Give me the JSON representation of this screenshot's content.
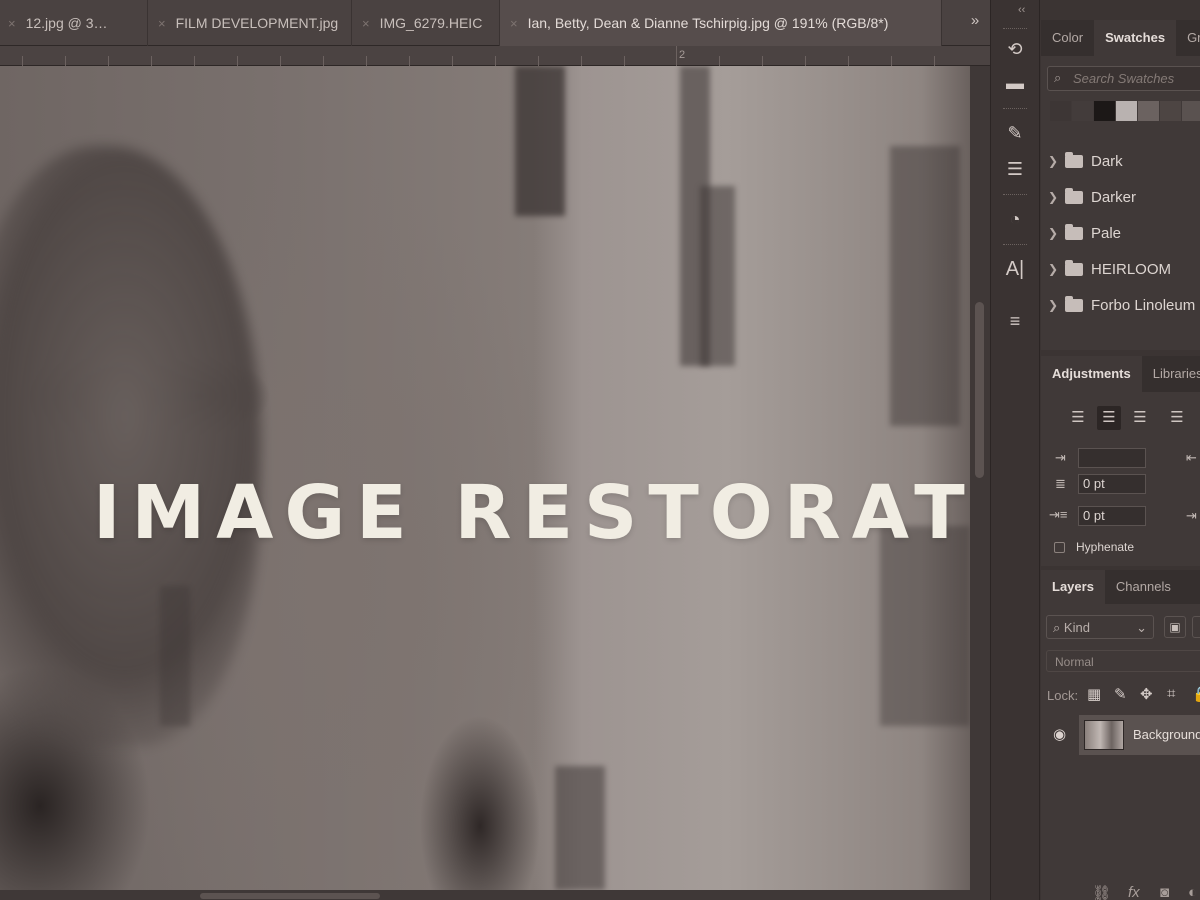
{
  "document_tabs": [
    {
      "label": "12.jpg @ 3…",
      "active": false
    },
    {
      "label": "FILM DEVELOPMENT.jpg",
      "active": false
    },
    {
      "label": "IMG_6279.HEIC",
      "active": false
    },
    {
      "label": "Ian, Betty, Dean & Dianne Tschirpig.jpg @ 191% (RGB/8*)",
      "active": true
    }
  ],
  "tab_close_glyph": "×",
  "tab_overflow_glyph": "»",
  "panel_collapse_glyph": "‹‹",
  "ruler": {
    "label": "2"
  },
  "canvas": {
    "overlay_title": "IMAGE RESTORATION"
  },
  "tools": [
    "history-brush-icon",
    "comment-icon",
    "brush-settings-icon",
    "tool-presets-icon",
    "clone-source-icon",
    "character-icon",
    "paragraph-settings-icon"
  ],
  "swatches_panel": {
    "tabs": [
      "Color",
      "Swatches",
      "Gra"
    ],
    "active_tab": "Swatches",
    "search_placeholder": "Search Swatches",
    "recent_swatches": [
      "#3d3635",
      "#433c3b",
      "#1c1817",
      "#b9b2b0",
      "#6b6260",
      "#4d4543",
      "#5a5250"
    ],
    "folders": [
      "Dark",
      "Darker",
      "Pale",
      "HEIRLOOM",
      "Forbo Linoleum"
    ]
  },
  "adjustments_panel": {
    "tabs": [
      "Adjustments",
      "Libraries"
    ],
    "indent_before": "0 pt",
    "indent_after": "0 pt",
    "hyphenate_label": "Hyphenate"
  },
  "layers_panel": {
    "tabs": [
      "Layers",
      "Channels"
    ],
    "active_tab": "Layers",
    "filter_kind": "Kind",
    "blend_mode": "Normal",
    "lock_label": "Lock:",
    "layers": [
      {
        "name": "Background",
        "visible": true
      }
    ]
  }
}
